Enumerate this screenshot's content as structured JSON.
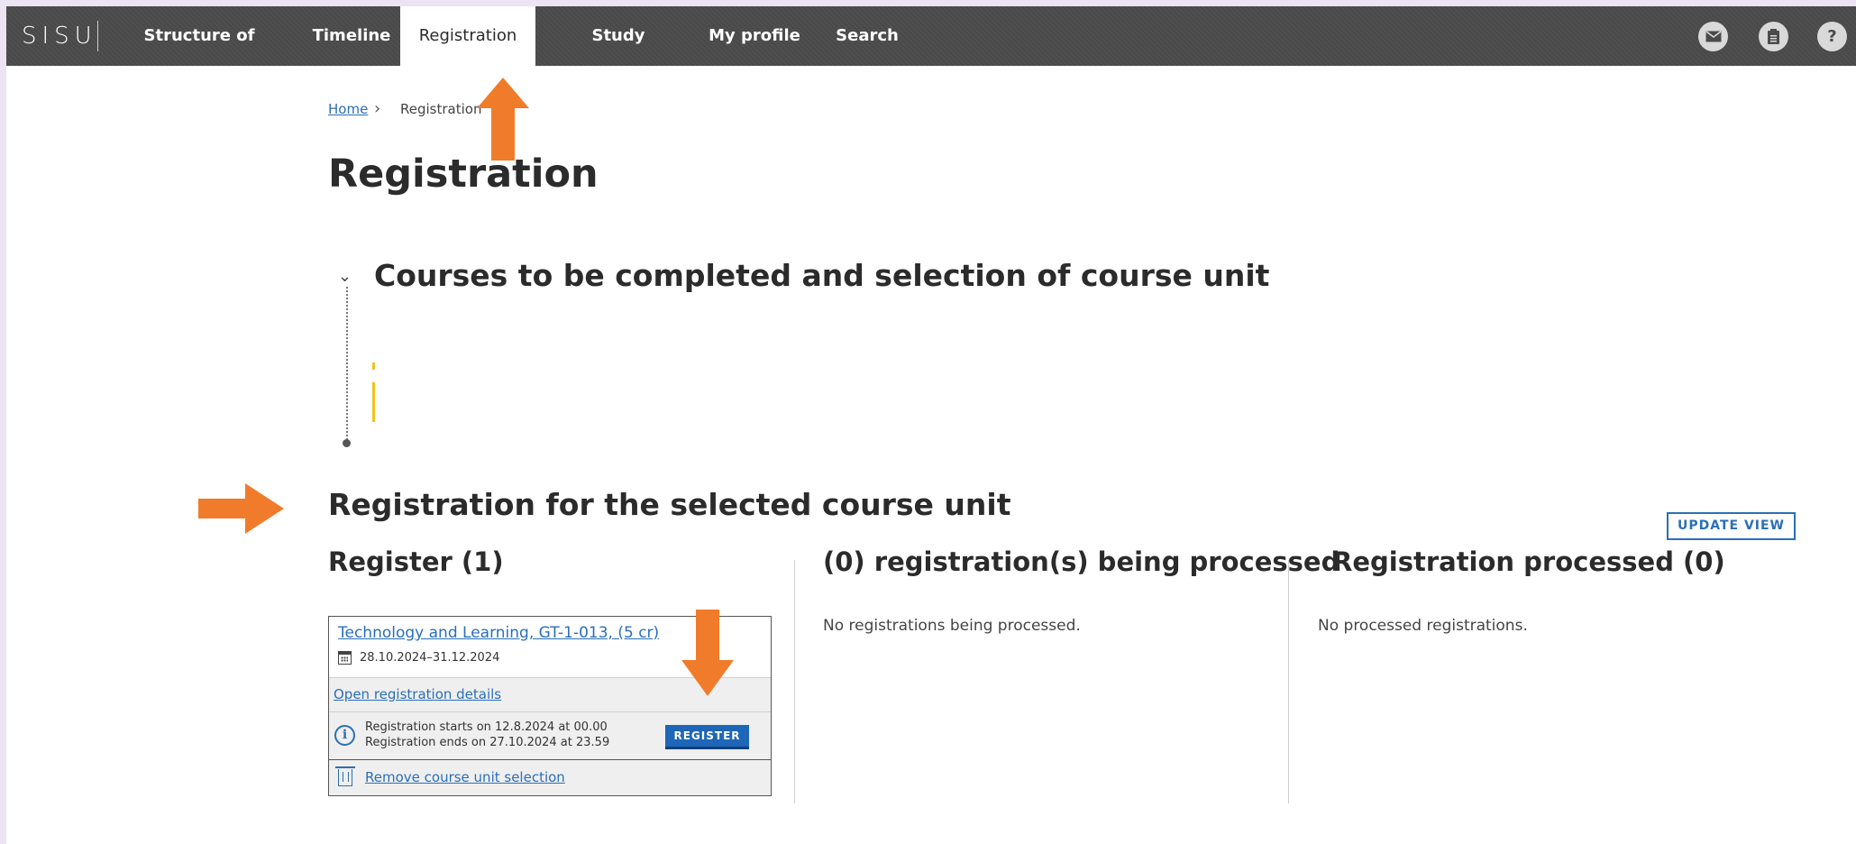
{
  "app": {
    "logo": "SISU",
    "nav": [
      {
        "label": "Structure of studies"
      },
      {
        "label": "Timeline"
      },
      {
        "label": "Registration",
        "active": true
      },
      {
        "label": "Study calendar"
      },
      {
        "label": "My profile"
      },
      {
        "label": "Search"
      }
    ],
    "icons": [
      "mail-icon",
      "notes-icon",
      "help-icon"
    ],
    "help_glyph": "?"
  },
  "breadcrumb": {
    "home": "Home",
    "current": "Registration"
  },
  "page_title": "Registration",
  "section_courses": {
    "title": "Courses to be completed and selection of course unit"
  },
  "section_registration": {
    "title": "Registration for the selected course unit",
    "update_button": "UPDATE VIEW",
    "columns": {
      "register": {
        "title": "Register (1)"
      },
      "processing": {
        "title": "(0) registration(s) being processed",
        "empty": "No registrations being processed."
      },
      "processed": {
        "title": "Registration processed (0)",
        "empty": "No processed registrations."
      }
    }
  },
  "course_card": {
    "title": "Technology and Learning, GT-1-013, (5 cr)",
    "dates": "28.10.2024–31.12.2024",
    "details_link": "Open registration details",
    "reg_start": "Registration starts on 12.8.2024 at 00.00",
    "reg_end": "Registration ends on 27.10.2024 at 23.59",
    "register_button": "REGISTER",
    "remove_link": "Remove course unit selection"
  },
  "colors": {
    "nav_bg": "#4b4b4b",
    "link": "#2a6fb8",
    "primary_button": "#1e66b8",
    "annotation_arrow": "#f07c2b"
  }
}
